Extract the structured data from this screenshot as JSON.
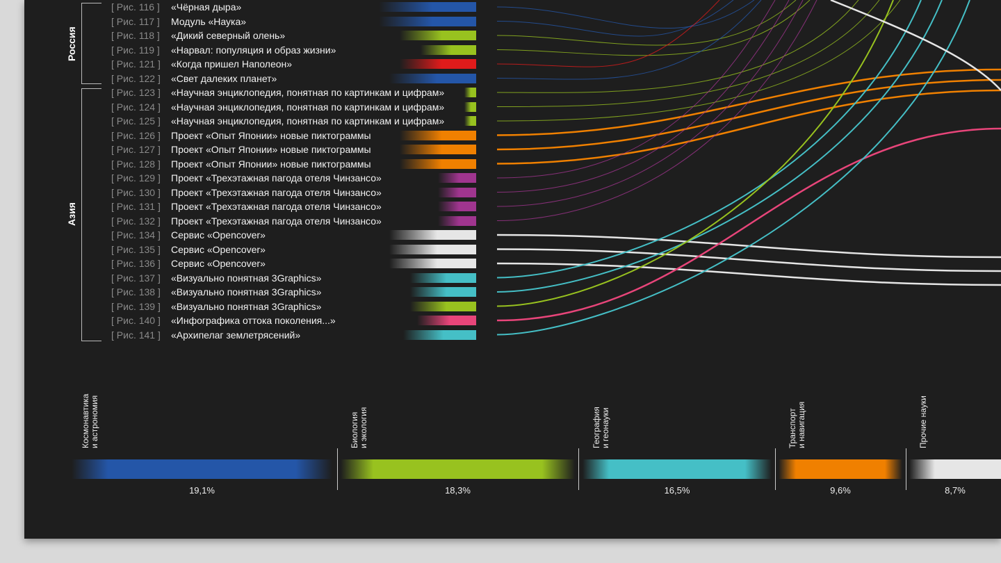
{
  "colors": {
    "space": "#2456a8",
    "bio": "#98c21f",
    "geo": "#45bfc6",
    "transport": "#f08000",
    "other": "#e6e6e6",
    "purple": "#a0358f",
    "red": "#e01b1b",
    "pink": "#e8457a"
  },
  "regions": [
    {
      "label": "Россия"
    },
    {
      "label": "Азия"
    }
  ],
  "rows": [
    {
      "ref": "[ Рис. 116 ]",
      "title": "«Чёрная дыра»",
      "color": "space"
    },
    {
      "ref": "[ Рис. 117 ]",
      "title": "Модуль «Наука»",
      "color": "space"
    },
    {
      "ref": "[ Рис. 118 ]",
      "title": "«Дикий северный олень»",
      "color": "bio"
    },
    {
      "ref": "[ Рис. 119 ]",
      "title": "«Нарвал: популяция и образ жизни»",
      "color": "bio"
    },
    {
      "ref": "[ Рис. 121 ]",
      "title": "«Когда пришел Наполеон»",
      "color": "red"
    },
    {
      "ref": "[ Рис. 122 ]",
      "title": "«Свет далеких планет»",
      "color": "space"
    },
    {
      "ref": "[ Рис. 123 ]",
      "title": "«Научная энциклопедия, понятная по картинкам и цифрам»",
      "color": "bio"
    },
    {
      "ref": "[ Рис. 124 ]",
      "title": "«Научная энциклопедия, понятная по картинкам и цифрам»",
      "color": "bio"
    },
    {
      "ref": "[ Рис. 125 ]",
      "title": "«Научная энциклопедия, понятная по картинкам и цифрам»",
      "color": "bio"
    },
    {
      "ref": "[ Рис. 126 ]",
      "title": "Проект «Опыт Японии» новые пиктограммы",
      "color": "transport"
    },
    {
      "ref": "[ Рис. 127 ]",
      "title": "Проект «Опыт Японии» новые пиктограммы",
      "color": "transport"
    },
    {
      "ref": "[ Рис. 128 ]",
      "title": "Проект «Опыт Японии» новые пиктограммы",
      "color": "transport"
    },
    {
      "ref": "[ Рис. 129 ]",
      "title": "Проект «Трехэтажная пагода отеля Чинзансо»",
      "color": "purple"
    },
    {
      "ref": "[ Рис. 130 ]",
      "title": "Проект «Трехэтажная пагода отеля Чинзансо»",
      "color": "purple"
    },
    {
      "ref": "[ Рис. 131 ]",
      "title": "Проект «Трехэтажная пагода отеля Чинзансо»",
      "color": "purple"
    },
    {
      "ref": "[ Рис. 132 ]",
      "title": "Проект «Трехэтажная пагода отеля Чинзансо»",
      "color": "purple"
    },
    {
      "ref": "[ Рис. 134 ]",
      "title": "Сервис «Opencover»",
      "color": "other"
    },
    {
      "ref": "[ Рис. 135 ]",
      "title": "Сервис «Opencover»",
      "color": "other"
    },
    {
      "ref": "[ Рис. 136 ]",
      "title": "Сервис «Opencover»",
      "color": "other"
    },
    {
      "ref": "[ Рис. 137 ]",
      "title": "«Визуально понятная 3Graphics»",
      "color": "geo"
    },
    {
      "ref": "[ Рис. 138 ]",
      "title": "«Визуально понятная 3Graphics»",
      "color": "geo"
    },
    {
      "ref": "[ Рис. 139 ]",
      "title": "«Визуально понятная 3Graphics»",
      "color": "bio"
    },
    {
      "ref": "[ Рис. 140 ]",
      "title": "«Инфографика оттока поколения...»",
      "color": "pink"
    },
    {
      "ref": "[ Рис. 141 ]",
      "title": "«Архипелаг землетрясений»",
      "color": "geo"
    }
  ],
  "categories": [
    {
      "label1": "Космонавтика",
      "label2": "и астрономия",
      "percent": "19,1%",
      "color": "space"
    },
    {
      "label1": "Биология",
      "label2": "и экология",
      "percent": "18,3%",
      "color": "bio"
    },
    {
      "label1": "География",
      "label2": "и геонауки",
      "percent": "16,5%",
      "color": "geo"
    },
    {
      "label1": "Транспорт",
      "label2": "и навигация",
      "percent": "9,6%",
      "color": "transport"
    },
    {
      "label1": "Прочие науки",
      "label2": "",
      "percent": "8,7%",
      "color": "other"
    }
  ]
}
